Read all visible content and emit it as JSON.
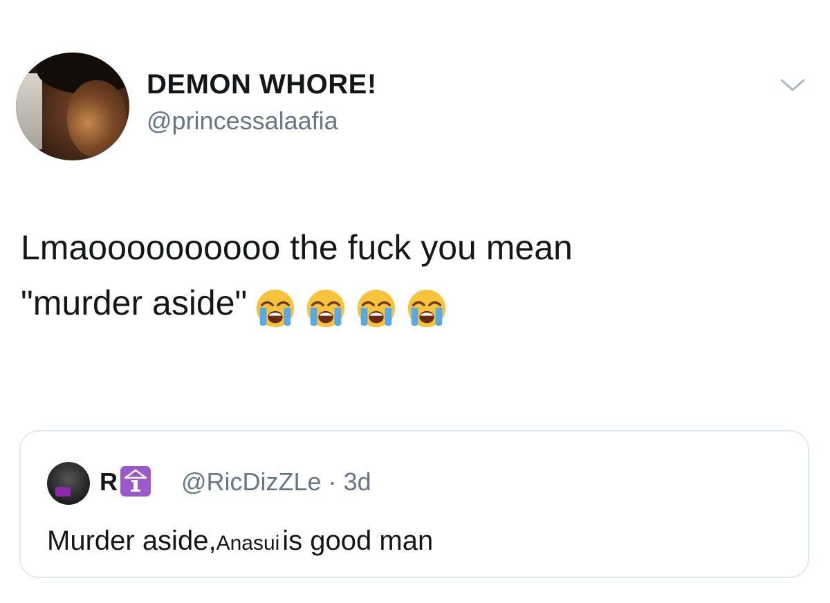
{
  "tweet": {
    "display_name": "DEMON WHORE!",
    "handle": "@princessalaafia",
    "text_line1": "Lmaoooooooooo the fuck you mean",
    "text_line2": "\"murder aside\"",
    "emojis": [
      "loudly-crying-face",
      "loudly-crying-face",
      "loudly-crying-face",
      "loudly-crying-face"
    ],
    "menu_icon": "chevron-down-icon"
  },
  "quoted_tweet": {
    "name": "R",
    "badge_icon": "info-keycap-icon",
    "handle": "@RicDizZLe",
    "separator": "·",
    "time": "3d",
    "text_before": "Murder aside,",
    "text_inserted": "Anasui",
    "text_after": "is good man"
  },
  "colors": {
    "text_primary": "#14171a",
    "text_secondary": "#657786",
    "card_border": "#e1e8ed",
    "badge_purple": "#9b59c9"
  }
}
